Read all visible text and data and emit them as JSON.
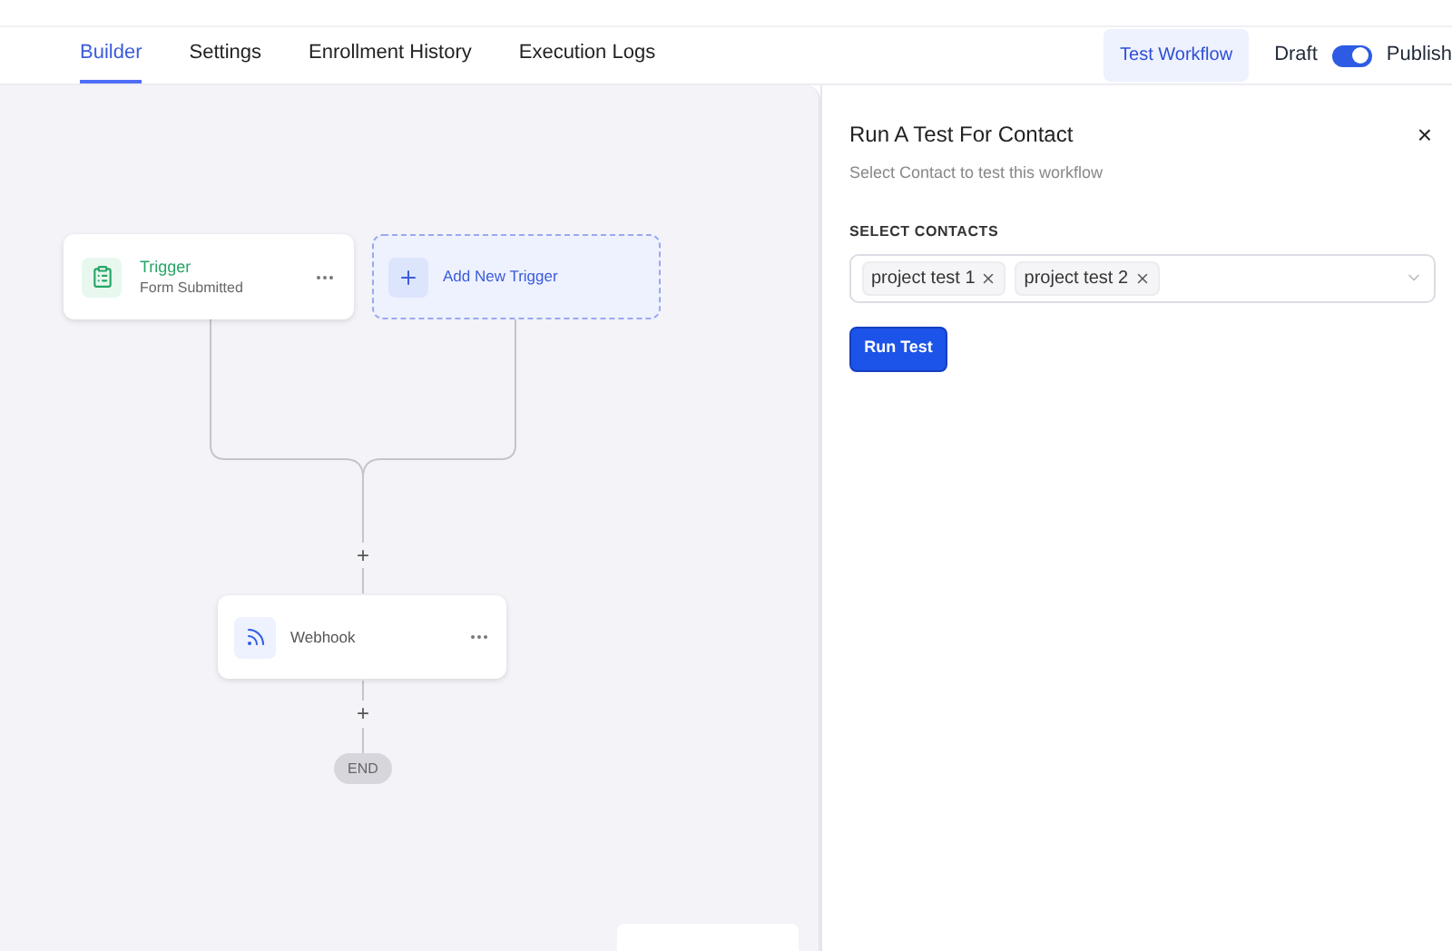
{
  "tabs": [
    {
      "label": "Builder",
      "selected": true
    },
    {
      "label": "Settings",
      "selected": false
    },
    {
      "label": "Enrollment History",
      "selected": false
    },
    {
      "label": "Execution Logs",
      "selected": false
    }
  ],
  "test_workflow_button": "Test Workflow",
  "publish_toggle": {
    "off_label": "Draft",
    "on_label": "Publish",
    "on": true
  },
  "canvas": {
    "trigger": {
      "title": "Trigger",
      "subtitle": "Form Submitted"
    },
    "add_trigger": "Add New Trigger",
    "add_step": [
      "+",
      "+"
    ],
    "action": {
      "title": "Webhook"
    },
    "end": "END"
  },
  "panel": {
    "title": "Run A Test For Contact",
    "close": "×",
    "subtitle": "Select Contact to test this workflow",
    "field_label": "SELECT CONTACTS",
    "contacts": [
      "project test 1",
      "project test 2"
    ],
    "run_button": "Run Test"
  }
}
